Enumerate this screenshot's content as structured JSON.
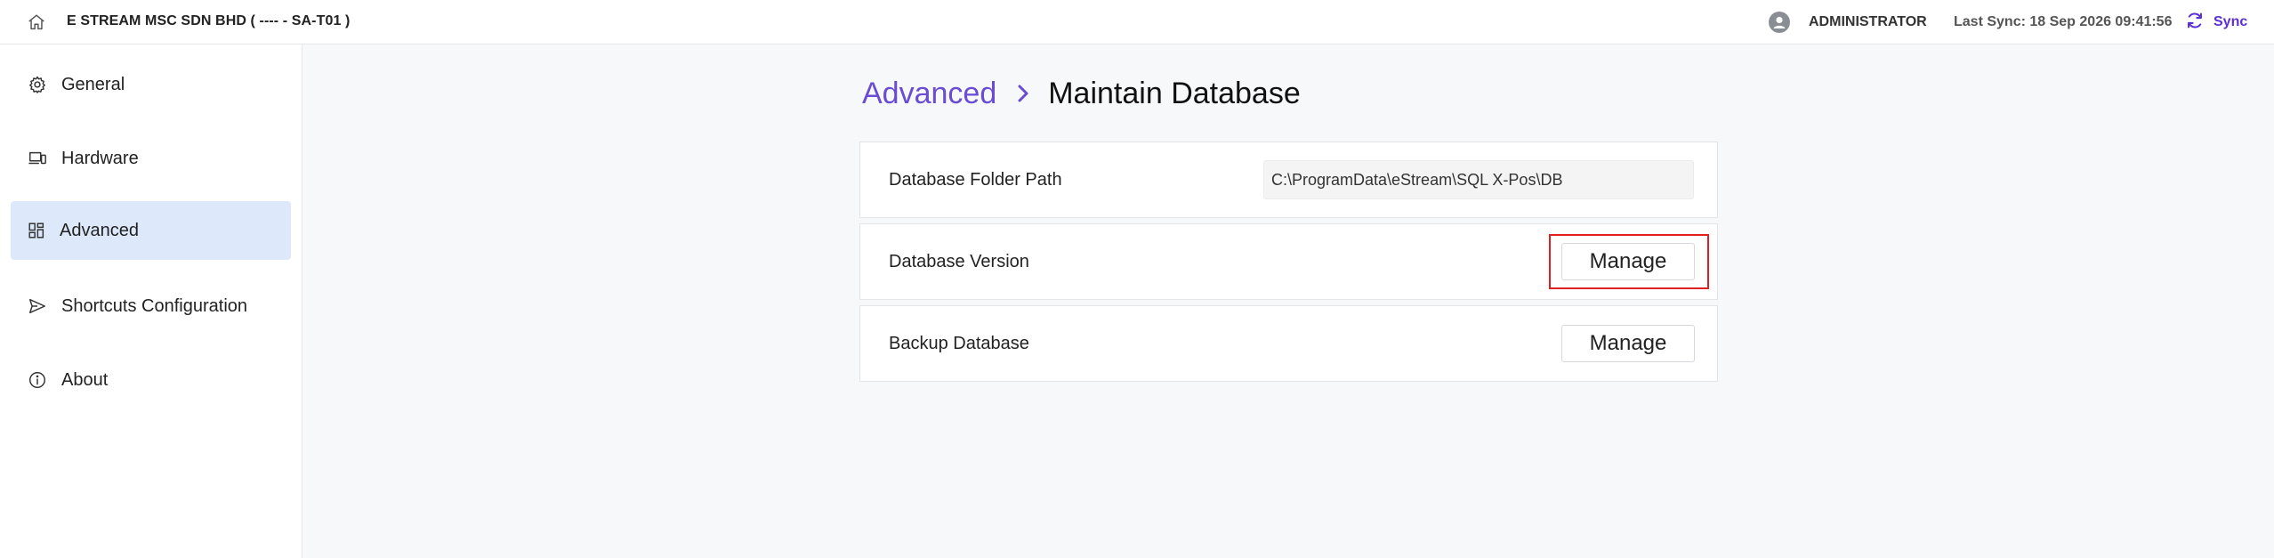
{
  "header": {
    "company": "E STREAM MSC SDN BHD ( ---- - SA-T01 )",
    "user": "ADMINISTRATOR",
    "last_sync": "Last Sync: 18 Sep 2026 09:41:56",
    "sync_label": "Sync",
    "accent_color": "#5b2fd4"
  },
  "sidebar": {
    "items": [
      {
        "label": "General",
        "icon": "gear-icon",
        "active": false
      },
      {
        "label": "Hardware",
        "icon": "devices-icon",
        "active": false
      },
      {
        "label": "Advanced",
        "icon": "grid-icon",
        "active": true
      },
      {
        "label": "Shortcuts Configuration",
        "icon": "send-icon",
        "active": false
      },
      {
        "label": "About",
        "icon": "info-icon",
        "active": false
      }
    ]
  },
  "main": {
    "breadcrumb": {
      "parent": "Advanced",
      "current": "Maintain Database"
    },
    "rows": [
      {
        "label": "Database Folder Path",
        "value": "C:\\ProgramData\\eStream\\SQL X-Pos\\DB"
      },
      {
        "label": "Database Version",
        "button": "Manage",
        "highlighted": true
      },
      {
        "label": "Backup Database",
        "button": "Manage",
        "highlighted": false
      }
    ]
  }
}
